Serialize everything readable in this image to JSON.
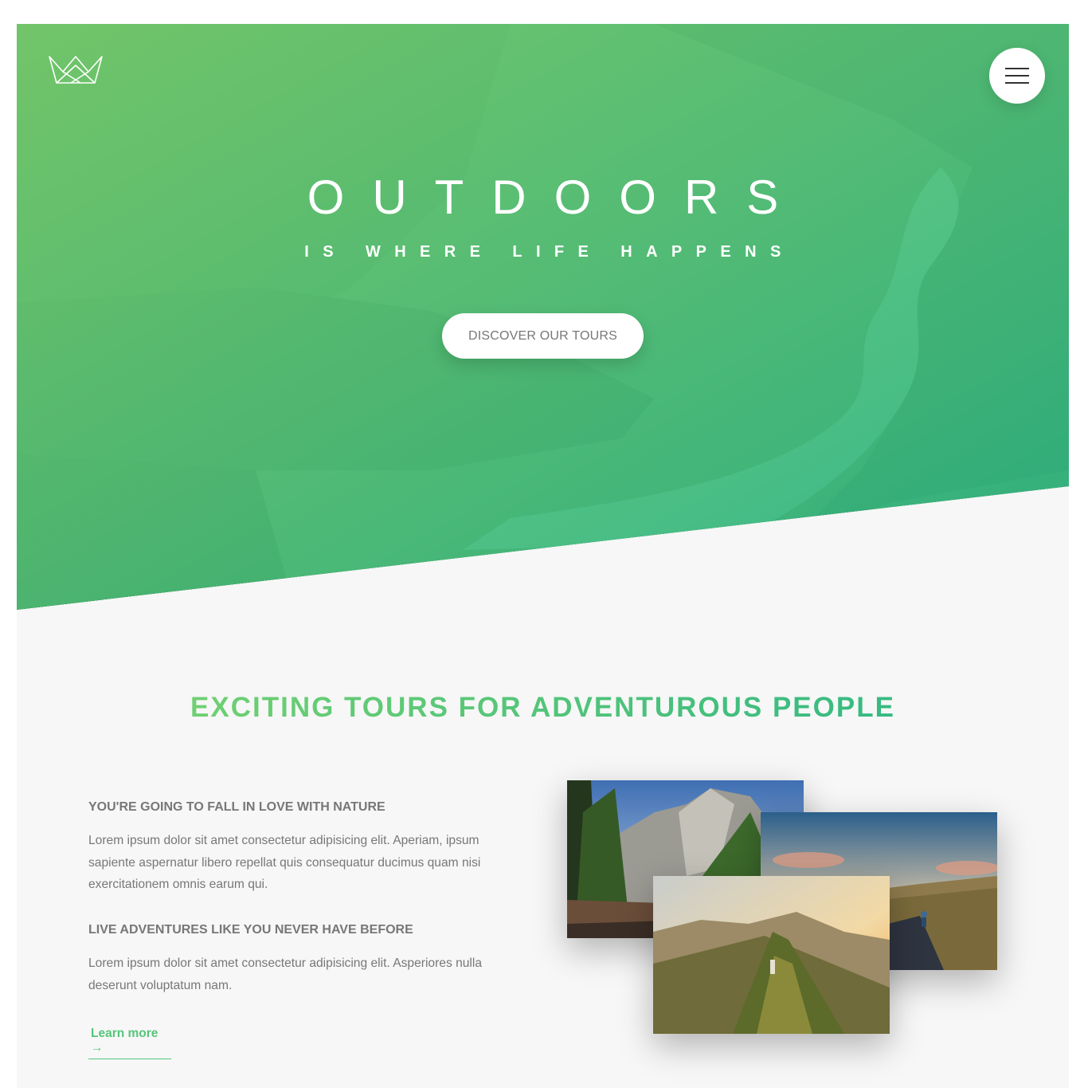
{
  "header": {
    "logo_icon": "crown-logo-icon",
    "menu_icon": "hamburger-menu-icon"
  },
  "hero": {
    "title": "OUTDOORS",
    "subtitle": "IS WHERE LIFE HAPPENS",
    "cta_label": "DISCOVER OUR TOURS",
    "gradient_start": "#7ed56f",
    "gradient_end": "#28b485"
  },
  "about": {
    "title": "EXCITING TOURS FOR ADVENTUROUS PEOPLE",
    "features": [
      {
        "heading": "YOU'RE GOING TO FALL IN LOVE WITH NATURE",
        "text": "Lorem ipsum dolor sit amet consectetur adipisicing elit. Aperiam, ipsum sapiente aspernatur libero repellat quis consequatur ducimus quam nisi exercitationem omnis earum qui."
      },
      {
        "heading": "LIVE ADVENTURES LIKE YOU NEVER HAVE BEFORE",
        "text": "Lorem ipsum dolor sit amet consectetur adipisicing elit. Asperiores nulla deserunt voluptatum nam."
      }
    ],
    "learn_more_label": "Learn more →",
    "accent_color": "#55c57a",
    "photos": [
      "forest-cliffs-photo",
      "hiker-road-photo",
      "mountain-ridge-sunset-photo"
    ]
  }
}
